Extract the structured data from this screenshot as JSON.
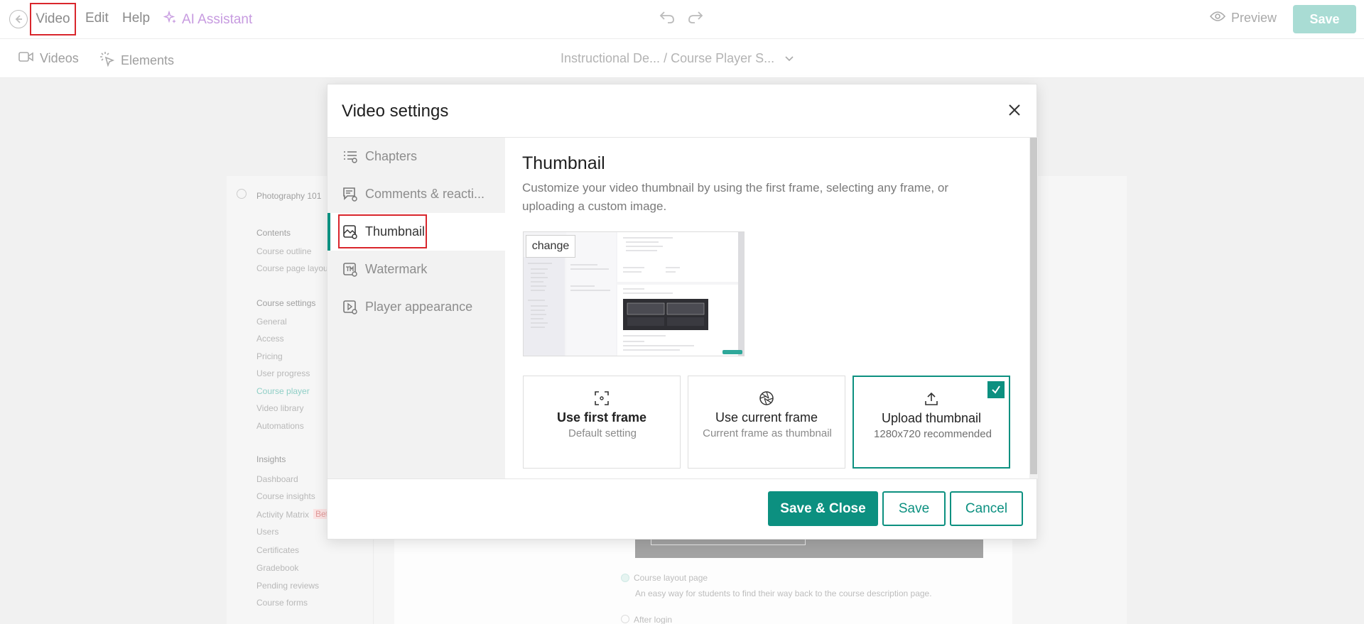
{
  "topbar": {
    "menu": {
      "video": "Video",
      "edit": "Edit",
      "help": "Help",
      "ai_assistant": "AI Assistant"
    },
    "preview": "Preview",
    "save": "Save"
  },
  "subbar": {
    "videos": "Videos",
    "elements": "Elements",
    "breadcrumb": "Instructional De...  / Course Player S..."
  },
  "background": {
    "course_title": "Photography 101",
    "sidebar": [
      {
        "section": "Contents",
        "items": [
          "Course outline",
          "Course page layout"
        ]
      },
      {
        "section": "Course settings",
        "items": [
          "General",
          "Access",
          "Pricing",
          "User progress",
          "Course player",
          "Video library",
          "Automations"
        ]
      },
      {
        "section": "Insights",
        "items": [
          "Dashboard",
          "Course insights",
          "Activity Matrix",
          "Users",
          "Certificates",
          "Gradebook",
          "Pending reviews",
          "Course forms"
        ]
      }
    ],
    "activity_badge": "Bet",
    "radio_1_label": "Course layout page",
    "radio_1_desc": "An easy way for students to find their way back to the course description page.",
    "radio_2_label": "After login"
  },
  "modal": {
    "title": "Video settings",
    "nav": [
      {
        "label": "Chapters",
        "icon": "chapters-icon"
      },
      {
        "label": "Comments & reacti...",
        "icon": "comments-icon"
      },
      {
        "label": "Thumbnail",
        "icon": "thumbnail-icon"
      },
      {
        "label": "Watermark",
        "icon": "watermark-icon"
      },
      {
        "label": "Player appearance",
        "icon": "player-appearance-icon"
      }
    ],
    "content": {
      "title": "Thumbnail",
      "description": "Customize your video thumbnail by using the first frame, selecting any frame, or uploading a custom image.",
      "change_label": "change",
      "options": [
        {
          "title": "Use first frame",
          "subtitle": "Default setting",
          "icon": "focus-frame-icon"
        },
        {
          "title": "Use current frame",
          "subtitle": "Current frame as thumbnail",
          "icon": "aperture-icon"
        },
        {
          "title": "Upload thumbnail",
          "subtitle": "1280x720 recommended",
          "icon": "upload-icon",
          "selected": true
        }
      ]
    },
    "buttons": {
      "save_close": "Save & Close",
      "save": "Save",
      "cancel": "Cancel"
    }
  },
  "colors": {
    "accent": "#0c9080",
    "highlight": "#d9262c",
    "ai": "#c79be0"
  }
}
